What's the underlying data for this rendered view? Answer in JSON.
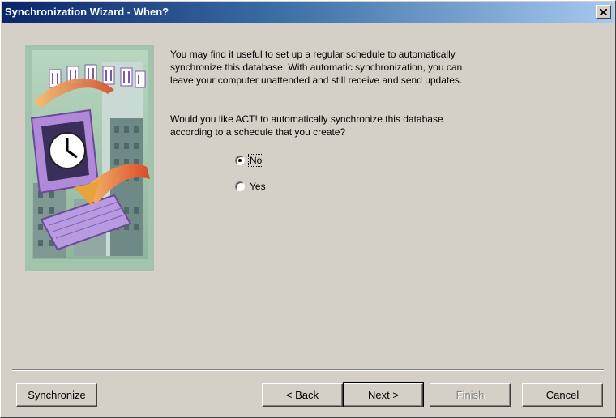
{
  "window": {
    "title": "Synchronization Wizard - When?"
  },
  "intro": {
    "line1": "You may find it useful to set up a regular schedule to automatically",
    "line2": "synchronize this database.  With automatic synchronization, you can",
    "line3": "leave your computer unattended and still receive and send updates."
  },
  "question": {
    "line1": "Would you like ACT! to automatically synchronize this database",
    "line2": "according to a schedule that you create?"
  },
  "options": {
    "no_label": "No",
    "yes_label": "Yes",
    "selected": "No"
  },
  "buttons": {
    "synchronize": "Synchronize",
    "back": "< Back",
    "next": "Next >",
    "finish": "Finish",
    "cancel": "Cancel"
  },
  "colors": {
    "titlebar_start": "#0a246a",
    "titlebar_end": "#a6caf0",
    "dialog_face": "#d4d0c8"
  }
}
